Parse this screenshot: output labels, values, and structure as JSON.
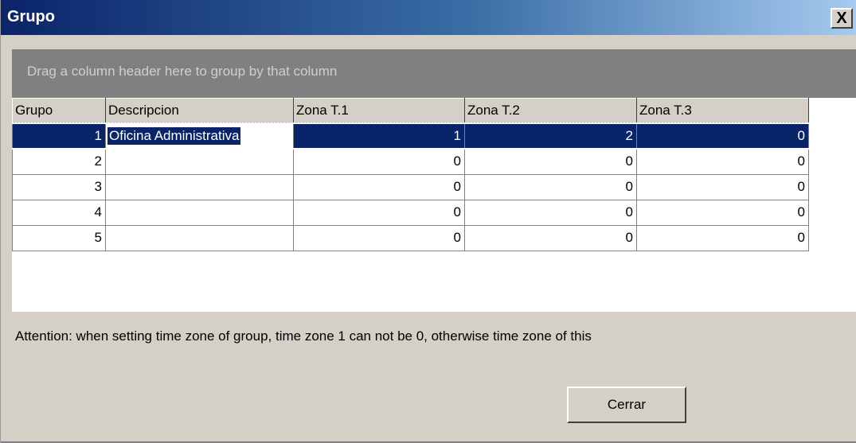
{
  "window": {
    "title": "Grupo",
    "close_glyph": "X"
  },
  "group_panel": {
    "hint": "Drag a column header here to group by that column"
  },
  "columns": [
    "Grupo",
    "Descripcion",
    "Zona T.1",
    "Zona T.2",
    "Zona T.3"
  ],
  "rows": [
    {
      "grupo": "1",
      "descripcion": "Oficina Administrativa",
      "zona1": "1",
      "zona2": "2",
      "zona3": "0",
      "selected": true
    },
    {
      "grupo": "2",
      "descripcion": "",
      "zona1": "0",
      "zona2": "0",
      "zona3": "0"
    },
    {
      "grupo": "3",
      "descripcion": "",
      "zona1": "0",
      "zona2": "0",
      "zona3": "0"
    },
    {
      "grupo": "4",
      "descripcion": "",
      "zona1": "0",
      "zona2": "0",
      "zona3": "0"
    },
    {
      "grupo": "5",
      "descripcion": "",
      "zona1": "0",
      "zona2": "0",
      "zona3": "0"
    }
  ],
  "notice": "Attention: when setting time zone of group, time zone 1 can not be 0, otherwise time zone of this",
  "buttons": {
    "close_label": "Cerrar"
  },
  "colors": {
    "title_gradient_start": "#0a246a",
    "title_gradient_end": "#a6caf0",
    "selection": "#0a246a",
    "face": "#d4d0c8"
  }
}
